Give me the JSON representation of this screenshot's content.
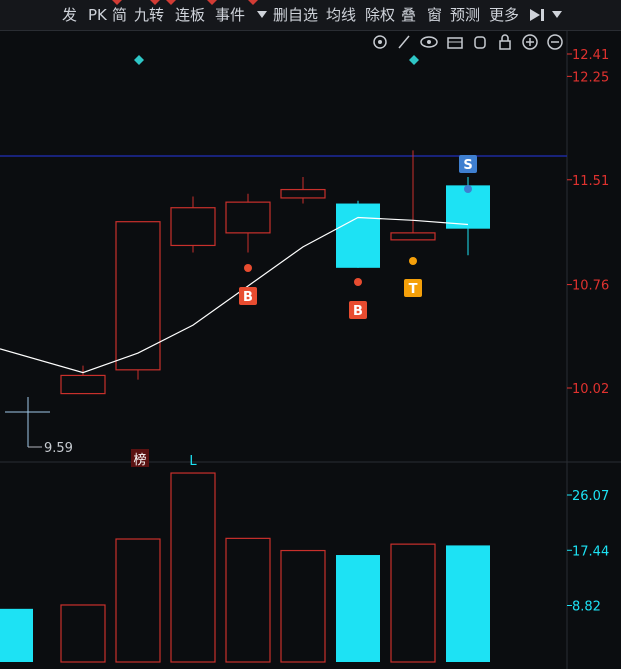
{
  "toolbar": {
    "items": [
      "发",
      "PK",
      "简",
      "九转",
      "连板",
      "事件",
      "删自选",
      "均线",
      "除权",
      "叠",
      "窗",
      "预测",
      "更多"
    ],
    "dropdown_icon": "triangle-down-icon",
    "collapse_icon": "collapse-right-icon",
    "more_dropdown_icon": "triangle-down-icon"
  },
  "price_axis": {
    "labels": [
      "12.41",
      "12.25",
      "11.51",
      "10.76",
      "10.02"
    ],
    "values": [
      12.41,
      12.25,
      11.51,
      10.76,
      10.02
    ]
  },
  "volume_axis": {
    "labels": [
      "26.07",
      "17.44",
      "8.82"
    ],
    "values": [
      26.07,
      17.44,
      8.82
    ]
  },
  "chart_tools": [
    "settings-icon",
    "pen-icon",
    "eye-icon",
    "toolbox-icon",
    "hand-icon",
    "lock-icon",
    "zoom-in-icon",
    "zoom-out-icon"
  ],
  "low_marker": {
    "label": "9.59",
    "value": 9.59
  },
  "bottom_marks": {
    "bang": "榜",
    "l": "L"
  },
  "signals": [
    "B",
    "B",
    "T",
    "S"
  ],
  "colors": {
    "background": "#0b0d10",
    "up": "#c9302c",
    "down": "#1de2f4",
    "ma_line": "#ffffff",
    "ref_line": "#1d2a9e",
    "axis_text": "#e0322f",
    "vol_axis_text": "#1de2f4",
    "buy_badge": "#e84c30",
    "t_badge": "#f5a00a",
    "s_badge": "#3f7fd0",
    "diamond": "#2ec6c6"
  },
  "chart_data": {
    "type": "candlestick",
    "price_range": [
      9.4,
      12.6
    ],
    "reference_line": 11.68,
    "candles": [
      {
        "open": 9.9,
        "close": 9.9,
        "high": 9.9,
        "low": 9.9,
        "dir": "down",
        "partial": true
      },
      {
        "open": 9.98,
        "close": 10.11,
        "high": 10.18,
        "low": 9.98,
        "dir": "up"
      },
      {
        "open": 10.15,
        "close": 11.21,
        "high": 11.21,
        "low": 10.08,
        "dir": "up"
      },
      {
        "open": 11.04,
        "close": 11.31,
        "high": 11.39,
        "low": 10.99,
        "dir": "up"
      },
      {
        "open": 11.13,
        "close": 11.35,
        "high": 11.41,
        "low": 10.99,
        "dir": "up"
      },
      {
        "open": 11.38,
        "close": 11.44,
        "high": 11.53,
        "low": 11.34,
        "dir": "up"
      },
      {
        "open": 11.34,
        "close": 10.88,
        "high": 11.36,
        "low": 10.88,
        "dir": "down"
      },
      {
        "open": 11.08,
        "close": 11.13,
        "high": 11.72,
        "low": 11.08,
        "dir": "up"
      },
      {
        "open": 11.47,
        "close": 11.16,
        "high": 11.53,
        "low": 10.97,
        "dir": "down"
      }
    ],
    "ma": [
      10.3,
      10.13,
      10.27,
      10.47,
      10.75,
      11.03,
      11.24,
      11.22,
      11.19
    ],
    "volumes": [
      8.3,
      8.9,
      19.2,
      29.5,
      19.3,
      17.4,
      16.7,
      18.4,
      18.2
    ],
    "volume_range": [
      0,
      30
    ]
  }
}
